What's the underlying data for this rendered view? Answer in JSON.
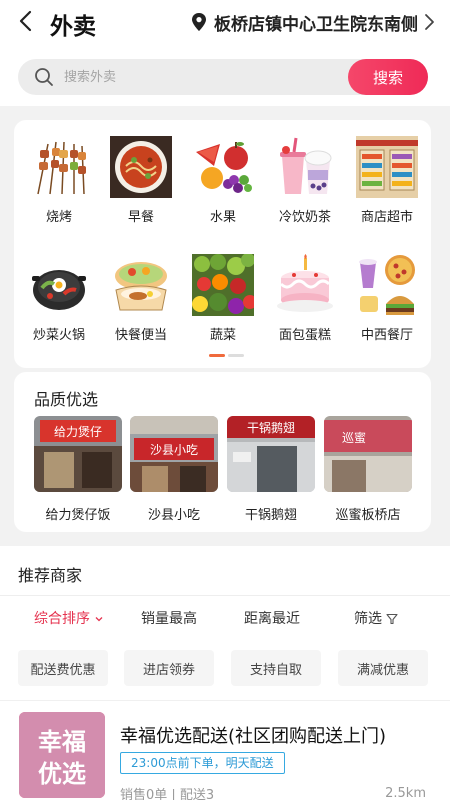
{
  "header": {
    "title": "外卖",
    "location": "板桥店镇中心卫生院东南侧"
  },
  "search": {
    "placeholder": "搜索外卖",
    "button_label": "搜索"
  },
  "categories": [
    {
      "label": "烧烤",
      "icon": "bbq-skewers-icon"
    },
    {
      "label": "早餐",
      "icon": "breakfast-noodle-icon"
    },
    {
      "label": "水果",
      "icon": "fruit-basket-icon"
    },
    {
      "label": "冷饮奶茶",
      "icon": "milk-tea-icon"
    },
    {
      "label": "商店超市",
      "icon": "supermarket-icon"
    },
    {
      "label": "炒菜火锅",
      "icon": "hotpot-icon"
    },
    {
      "label": "快餐便当",
      "icon": "bento-box-icon"
    },
    {
      "label": "蔬菜",
      "icon": "vegetables-icon"
    },
    {
      "label": "面包蛋糕",
      "icon": "birthday-cake-icon"
    },
    {
      "label": "中西餐厅",
      "icon": "western-food-icon"
    }
  ],
  "quality": {
    "title": "品质优选",
    "shops": [
      {
        "name": "给力煲仔饭",
        "sign_text": "给力煲仔",
        "sign_color": "#d8342c"
      },
      {
        "name": "沙县小吃",
        "sign_text": "沙县小吃",
        "sign_color": "#c8262a"
      },
      {
        "name": "干锅鹅翅",
        "sign_text": "干锅鹅翅",
        "sign_color": "#b32126"
      },
      {
        "name": "巡蜜板桥店",
        "sign_text": "巡蜜",
        "sign_color": "#c94a5b"
      }
    ]
  },
  "recommend": {
    "title": "推荐商家",
    "sort_options": [
      "综合排序",
      "销量最高",
      "距离最近",
      "筛选"
    ],
    "filter_chips": [
      "配送费优惠",
      "进店领券",
      "支持自取",
      "满减优惠"
    ]
  },
  "merchant": {
    "logo_text_1": "幸福",
    "logo_text_2": "优选",
    "name": "幸福优选配送(社区团购配送上门)",
    "tag": "23:00点前下单，明天配送",
    "sales": "销售0单 | 配送3",
    "distance": "2.5km"
  },
  "colors": {
    "accent": "#ef2a57",
    "active_sort": "#e5334f",
    "tag_blue": "#2d9bd6"
  }
}
